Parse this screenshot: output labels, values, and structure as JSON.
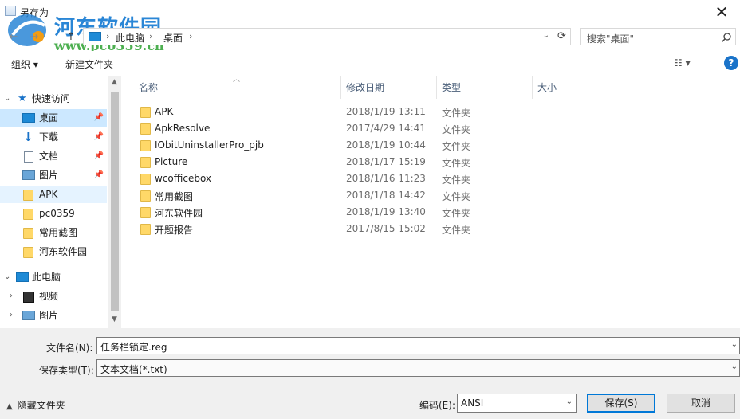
{
  "window": {
    "title": "另存为",
    "close_glyph": "✕"
  },
  "watermark": {
    "text": "河东软件园",
    "url": "www.pc0359.cn"
  },
  "nav": {
    "back": "←",
    "forward": "→",
    "up": "↑",
    "breadcrumb": [
      "此电脑",
      "桌面"
    ],
    "separator": "›",
    "dropdown": "⌄",
    "refresh": "⟳",
    "search_placeholder": "搜索\"桌面\"",
    "search_icon": "search-icon"
  },
  "toolbar": {
    "organize": "组织 ▾",
    "new_folder": "新建文件夹",
    "view": "☷ ▾",
    "help": "?"
  },
  "sidebar": {
    "items": [
      {
        "label": "快速访问",
        "icon": "star-icon",
        "level": 0,
        "expanded": true
      },
      {
        "label": "桌面",
        "icon": "desktop-icon",
        "level": 1,
        "pinned": true,
        "state": "selected"
      },
      {
        "label": "下载",
        "icon": "download-icon",
        "level": 1,
        "pinned": true
      },
      {
        "label": "文档",
        "icon": "document-icon",
        "level": 1,
        "pinned": true
      },
      {
        "label": "图片",
        "icon": "picture-icon",
        "level": 1,
        "pinned": true
      },
      {
        "label": "APK",
        "icon": "folder-icon",
        "level": 1,
        "state": "hover"
      },
      {
        "label": "pc0359",
        "icon": "folder-icon",
        "level": 1
      },
      {
        "label": "常用截图",
        "icon": "folder-icon",
        "level": 1
      },
      {
        "label": "河东软件园",
        "icon": "folder-icon",
        "level": 1
      },
      {
        "label": "此电脑",
        "icon": "computer-icon",
        "level": 0,
        "expanded": true
      },
      {
        "label": "视频",
        "icon": "video-icon",
        "level": 1,
        "collapsed": true
      },
      {
        "label": "图片",
        "icon": "picture-icon",
        "level": 1,
        "collapsed": true
      }
    ]
  },
  "columns": {
    "name": "名称",
    "modified": "修改日期",
    "type": "类型",
    "size": "大小"
  },
  "files": [
    {
      "name": "APK",
      "modified": "2018/1/19 13:11",
      "type": "文件夹"
    },
    {
      "name": "ApkResolve",
      "modified": "2017/4/29 14:41",
      "type": "文件夹"
    },
    {
      "name": "IObitUninstallerPro_pjb",
      "modified": "2018/1/19 10:44",
      "type": "文件夹"
    },
    {
      "name": "Picture",
      "modified": "2018/1/17 15:19",
      "type": "文件夹"
    },
    {
      "name": "wcofficebox",
      "modified": "2018/1/16 11:23",
      "type": "文件夹"
    },
    {
      "name": "常用截图",
      "modified": "2018/1/18 14:42",
      "type": "文件夹"
    },
    {
      "name": "河东软件园",
      "modified": "2018/1/19 13:40",
      "type": "文件夹"
    },
    {
      "name": "开题报告",
      "modified": "2017/8/15 15:02",
      "type": "文件夹"
    }
  ],
  "save": {
    "filename_label": "文件名(N):",
    "filename_value": "任务栏锁定.reg",
    "filetype_label": "保存类型(T):",
    "filetype_value": "文本文档(*.txt)",
    "hide_folders": "隐藏文件夹",
    "encoding_label": "编码(E):",
    "encoding_value": "ANSI",
    "save_button": "保存(S)",
    "cancel_button": "取消"
  },
  "colors": {
    "selection": "#cce8ff",
    "hover": "#e5f3ff",
    "accent": "#0078d7",
    "folder": "#ffd868"
  }
}
